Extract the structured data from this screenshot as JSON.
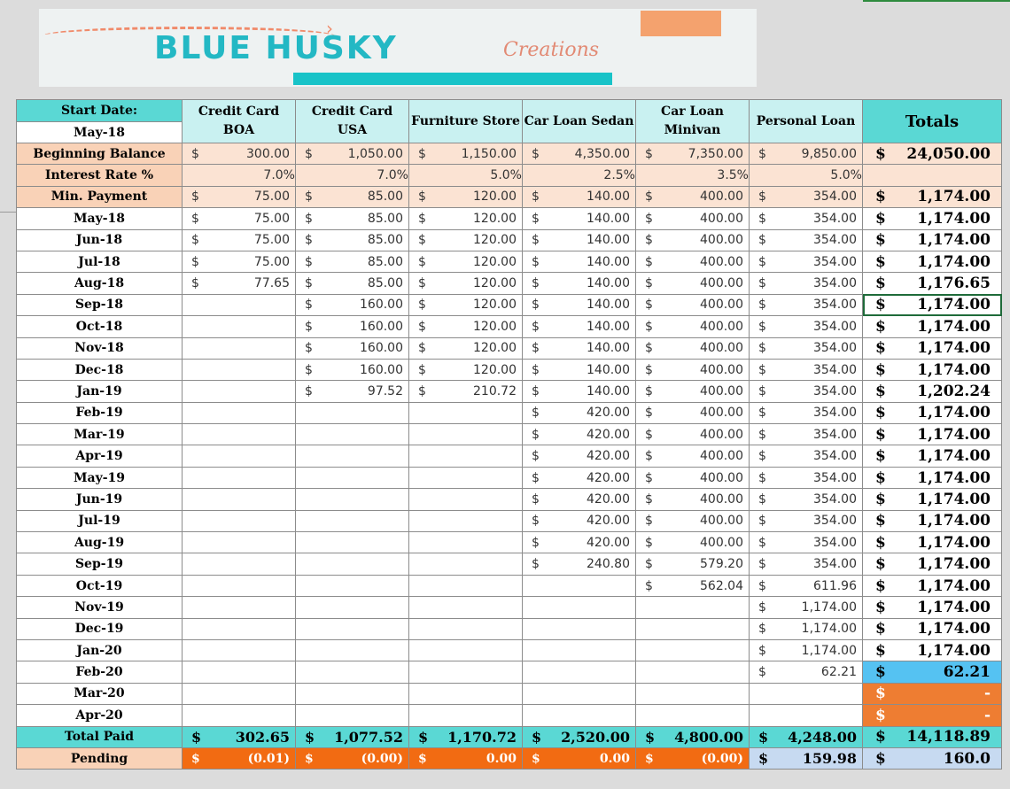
{
  "banner": {
    "brand": "BLUE HUSKY",
    "sub": "Creations"
  },
  "header": {
    "start_label": "Start Date:",
    "start_value": "May-18",
    "cols": [
      "Credit Card BOA",
      "Credit Card USA",
      "Furniture Store",
      "Car Loan Sedan",
      "Car Loan Minivan",
      "Personal Loan"
    ],
    "totals": "Totals"
  },
  "beginning": {
    "label": "Beginning Balance",
    "values": [
      "300.00",
      "1,050.00",
      "1,150.00",
      "4,350.00",
      "7,350.00",
      "9,850.00"
    ],
    "total": "24,050.00"
  },
  "rate": {
    "label": "Interest Rate %",
    "values": [
      "7.0%",
      "7.0%",
      "5.0%",
      "2.5%",
      "3.5%",
      "5.0%"
    ]
  },
  "minpay": {
    "label": "Min. Payment",
    "values": [
      "75.00",
      "85.00",
      "120.00",
      "140.00",
      "400.00",
      "354.00"
    ],
    "total": "1,174.00"
  },
  "rows": [
    {
      "m": "May-18",
      "v": [
        "75.00",
        "85.00",
        "120.00",
        "140.00",
        "400.00",
        "354.00"
      ],
      "t": "1,174.00"
    },
    {
      "m": "Jun-18",
      "v": [
        "75.00",
        "85.00",
        "120.00",
        "140.00",
        "400.00",
        "354.00"
      ],
      "t": "1,174.00"
    },
    {
      "m": "Jul-18",
      "v": [
        "75.00",
        "85.00",
        "120.00",
        "140.00",
        "400.00",
        "354.00"
      ],
      "t": "1,174.00"
    },
    {
      "m": "Aug-18",
      "v": [
        "77.65",
        "85.00",
        "120.00",
        "140.00",
        "400.00",
        "354.00"
      ],
      "t": "1,176.65"
    },
    {
      "m": "Sep-18",
      "v": [
        "",
        "160.00",
        "120.00",
        "140.00",
        "400.00",
        "354.00"
      ],
      "t": "1,174.00"
    },
    {
      "m": "Oct-18",
      "v": [
        "",
        "160.00",
        "120.00",
        "140.00",
        "400.00",
        "354.00"
      ],
      "t": "1,174.00"
    },
    {
      "m": "Nov-18",
      "v": [
        "",
        "160.00",
        "120.00",
        "140.00",
        "400.00",
        "354.00"
      ],
      "t": "1,174.00"
    },
    {
      "m": "Dec-18",
      "v": [
        "",
        "160.00",
        "120.00",
        "140.00",
        "400.00",
        "354.00"
      ],
      "t": "1,174.00"
    },
    {
      "m": "Jan-19",
      "v": [
        "",
        "97.52",
        "210.72",
        "140.00",
        "400.00",
        "354.00"
      ],
      "t": "1,202.24"
    },
    {
      "m": "Feb-19",
      "v": [
        "",
        "",
        "",
        "420.00",
        "400.00",
        "354.00"
      ],
      "t": "1,174.00"
    },
    {
      "m": "Mar-19",
      "v": [
        "",
        "",
        "",
        "420.00",
        "400.00",
        "354.00"
      ],
      "t": "1,174.00"
    },
    {
      "m": "Apr-19",
      "v": [
        "",
        "",
        "",
        "420.00",
        "400.00",
        "354.00"
      ],
      "t": "1,174.00"
    },
    {
      "m": "May-19",
      "v": [
        "",
        "",
        "",
        "420.00",
        "400.00",
        "354.00"
      ],
      "t": "1,174.00"
    },
    {
      "m": "Jun-19",
      "v": [
        "",
        "",
        "",
        "420.00",
        "400.00",
        "354.00"
      ],
      "t": "1,174.00"
    },
    {
      "m": "Jul-19",
      "v": [
        "",
        "",
        "",
        "420.00",
        "400.00",
        "354.00"
      ],
      "t": "1,174.00"
    },
    {
      "m": "Aug-19",
      "v": [
        "",
        "",
        "",
        "420.00",
        "400.00",
        "354.00"
      ],
      "t": "1,174.00"
    },
    {
      "m": "Sep-19",
      "v": [
        "",
        "",
        "",
        "240.80",
        "579.20",
        "354.00"
      ],
      "t": "1,174.00"
    },
    {
      "m": "Oct-19",
      "v": [
        "",
        "",
        "",
        "",
        "562.04",
        "611.96"
      ],
      "t": "1,174.00"
    },
    {
      "m": "Nov-19",
      "v": [
        "",
        "",
        "",
        "",
        "",
        "1,174.00"
      ],
      "t": "1,174.00"
    },
    {
      "m": "Dec-19",
      "v": [
        "",
        "",
        "",
        "",
        "",
        "1,174.00"
      ],
      "t": "1,174.00"
    },
    {
      "m": "Jan-20",
      "v": [
        "",
        "",
        "",
        "",
        "",
        "1,174.00"
      ],
      "t": "1,174.00"
    },
    {
      "m": "Feb-20",
      "v": [
        "",
        "",
        "",
        "",
        "",
        "62.21"
      ],
      "t": "62.21"
    },
    {
      "m": "Mar-20",
      "v": [
        "",
        "",
        "",
        "",
        "",
        ""
      ],
      "t": "-"
    },
    {
      "m": "Apr-20",
      "v": [
        "",
        "",
        "",
        "",
        "",
        ""
      ],
      "t": "-"
    }
  ],
  "total_paid": {
    "label": "Total Paid",
    "values": [
      "302.65",
      "1,077.52",
      "1,170.72",
      "2,520.00",
      "4,800.00",
      "4,248.00"
    ],
    "total": "14,118.89"
  },
  "pending": {
    "label": "Pending",
    "values": [
      "(0.01)",
      "(0.00)",
      "0.00",
      "0.00",
      "(0.00)",
      "159.98"
    ],
    "total": "160.0"
  },
  "currency": "$",
  "colors": {
    "teal": "#5ad8d4",
    "salmon": "#f9d2b7",
    "orange": "#f26b12",
    "blue": "#c7daf1"
  }
}
